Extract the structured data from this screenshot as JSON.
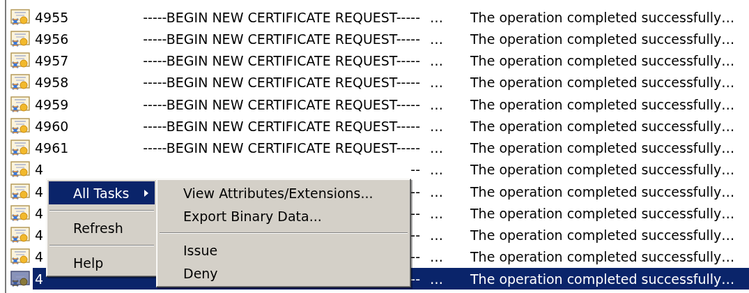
{
  "requests": [
    {
      "id": "4955",
      "request": "-----BEGIN NEW CERTIFICATE REQUEST-----",
      "more": "…",
      "status": "The operation completed successfully…",
      "selected": false
    },
    {
      "id": "4956",
      "request": "-----BEGIN NEW CERTIFICATE REQUEST-----",
      "more": "…",
      "status": "The operation completed successfully…",
      "selected": false
    },
    {
      "id": "4957",
      "request": "-----BEGIN NEW CERTIFICATE REQUEST-----",
      "more": "…",
      "status": "The operation completed successfully…",
      "selected": false
    },
    {
      "id": "4958",
      "request": "-----BEGIN NEW CERTIFICATE REQUEST-----",
      "more": "…",
      "status": "The operation completed successfully…",
      "selected": false
    },
    {
      "id": "4959",
      "request": "-----BEGIN NEW CERTIFICATE REQUEST-----",
      "more": "…",
      "status": "The operation completed successfully…",
      "selected": false
    },
    {
      "id": "4960",
      "request": "-----BEGIN NEW CERTIFICATE REQUEST-----",
      "more": "…",
      "status": "The operation completed successfully…",
      "selected": false
    },
    {
      "id": "4961",
      "request": "-----BEGIN NEW CERTIFICATE REQUEST-----",
      "more": "…",
      "status": "The operation completed successfully…",
      "selected": false
    },
    {
      "id": "4",
      "request": "--",
      "more": "…",
      "status": "The operation completed successfully…",
      "selected": false
    },
    {
      "id": "4",
      "request": "--",
      "more": "…",
      "status": "The operation completed successfully…",
      "selected": false
    },
    {
      "id": "4",
      "request": "--",
      "more": "…",
      "status": "The operation completed successfully…",
      "selected": false
    },
    {
      "id": "4",
      "request": "--",
      "more": "…",
      "status": "The operation completed successfully…",
      "selected": false
    },
    {
      "id": "4",
      "request": "--",
      "more": "…",
      "status": "The operation completed successfully…",
      "selected": false
    },
    {
      "id": "4",
      "request": "--",
      "more": "…",
      "status": "The operation completed successfully…",
      "selected": true
    }
  ],
  "context_menu": {
    "items": [
      {
        "kind": "item",
        "label": "All Tasks",
        "selected": true,
        "submenu": true
      },
      {
        "kind": "separator"
      },
      {
        "kind": "item",
        "label": "Refresh",
        "selected": false,
        "submenu": false
      },
      {
        "kind": "separator"
      },
      {
        "kind": "item",
        "label": "Help",
        "selected": false,
        "submenu": false
      }
    ],
    "submenu": [
      {
        "kind": "item",
        "label": "View Attributes/Extensions...",
        "selected": false
      },
      {
        "kind": "item",
        "label": "Export Binary Data...",
        "selected": false
      },
      {
        "kind": "separator"
      },
      {
        "kind": "item",
        "label": "Issue",
        "selected": false
      },
      {
        "kind": "item",
        "label": "Deny",
        "selected": false
      }
    ]
  }
}
